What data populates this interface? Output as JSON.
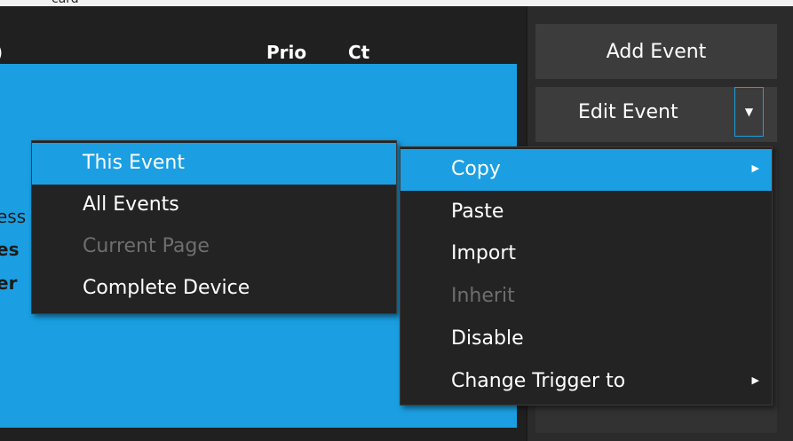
{
  "window": {
    "top_fragment": "card"
  },
  "table": {
    "headers": {
      "paren": ")",
      "prio": "Prio",
      "ct": "Ct"
    },
    "partial_rows": [
      "ess",
      "es",
      "er"
    ]
  },
  "buttons": {
    "add_event": "Add Event",
    "edit_event": "Edit Event"
  },
  "icons": {
    "dropdown": "chevron-down-icon",
    "submenu_arrow": "chevron-right-icon"
  },
  "scope_menu": {
    "items": [
      {
        "label": "This Event",
        "state": "highlighted"
      },
      {
        "label": "All Events",
        "state": "enabled"
      },
      {
        "label": "Current Page",
        "state": "disabled"
      },
      {
        "label": "Complete Device",
        "state": "enabled"
      }
    ]
  },
  "context_menu": {
    "items": [
      {
        "label": "Copy",
        "state": "highlighted",
        "submenu": true
      },
      {
        "label": "Paste",
        "state": "enabled"
      },
      {
        "label": "Import",
        "state": "enabled"
      },
      {
        "label": "Inherit",
        "state": "disabled"
      },
      {
        "label": "Disable",
        "state": "enabled"
      },
      {
        "label": "Change Trigger to",
        "state": "enabled",
        "submenu": true
      }
    ]
  },
  "colors": {
    "accent": "#1b9fe2",
    "background": "#2b2b2b",
    "menu": "#232323",
    "disabled_text": "#6e6e6e"
  }
}
